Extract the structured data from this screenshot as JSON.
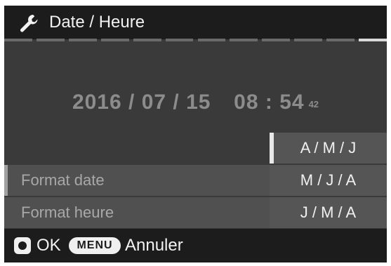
{
  "header": {
    "icon": "wrench-icon",
    "title": "Date / Heure",
    "page_count": 12,
    "active_page": 11
  },
  "datetime": {
    "year": "2016",
    "month": "07",
    "day": "15",
    "hour": "08",
    "minute": "54",
    "second": "42",
    "date_sep": " / ",
    "time_sep": " : "
  },
  "settings": [
    {
      "label": "Format date"
    },
    {
      "label": "Format heure"
    }
  ],
  "format_options": [
    {
      "label": "A / M / J"
    },
    {
      "label": "M / J / A"
    },
    {
      "label": "J / M / A"
    }
  ],
  "selected_option_index": 0,
  "footer": {
    "ok_label": "OK",
    "menu_button_label": "MENU",
    "cancel_label": "Annuler"
  },
  "colors": {
    "header_bg": "#1c1c1c",
    "screen_bg": "#3a3a3a",
    "row_bg": "#505050",
    "text_dim": "#a8a8a8",
    "text_bright": "#f0f0f0"
  }
}
